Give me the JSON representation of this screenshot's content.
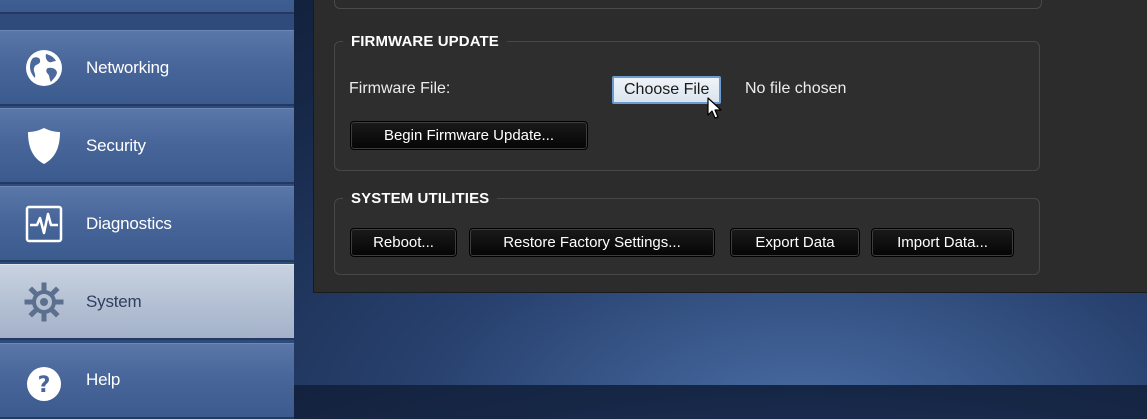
{
  "sidebar": {
    "items": [
      {
        "label": "Networking",
        "icon": "globe-icon",
        "active": false
      },
      {
        "label": "Security",
        "icon": "shield-icon",
        "active": false
      },
      {
        "label": "Diagnostics",
        "icon": "pulse-monitor-icon",
        "active": false
      },
      {
        "label": "System",
        "icon": "gear-icon",
        "active": true
      },
      {
        "label": "Help",
        "icon": "help-icon",
        "active": false
      }
    ]
  },
  "firmware_update": {
    "legend": "FIRMWARE UPDATE",
    "file_label": "Firmware File:",
    "choose_file_label": "Choose File",
    "file_status": "No file chosen",
    "begin_button": "Begin Firmware Update..."
  },
  "system_utilities": {
    "legend": "SYSTEM UTILITIES",
    "buttons": [
      "Reboot...",
      "Restore Factory Settings...",
      "Export Data",
      "Import Data..."
    ]
  },
  "colors": {
    "sidebar_item": "#48669a",
    "sidebar_active": "#b5c1d4",
    "panel_bg": "#2c2c2c",
    "button_bg": "#0b0b0b",
    "choose_file_border": "#6b9bd1"
  }
}
